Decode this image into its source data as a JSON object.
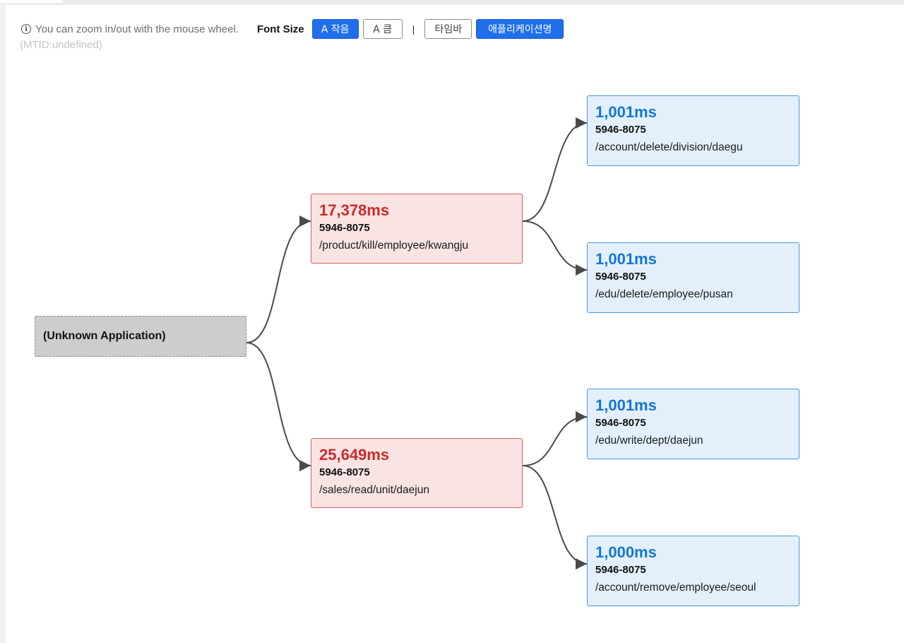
{
  "toolbar": {
    "hint": "You can zoom in/out with the mouse wheel.",
    "font_size_label": "Font Size",
    "btn_small": "A 작음",
    "btn_large": "A 큼",
    "separator": "|",
    "btn_timebar": "타임바",
    "btn_appname": "애플리케이션명"
  },
  "mtid": "(MTID:undefined)",
  "colors": {
    "slow": "#cc2b2b",
    "normal": "#1477d4",
    "accent": "#1f6feb"
  },
  "nodes": {
    "root": {
      "label": "(Unknown Application)"
    },
    "n1": {
      "ms": "17,378ms",
      "id": "5946-8075",
      "path": "/product/kill/employee/kwangju"
    },
    "n2": {
      "ms": "25,649ms",
      "id": "5946-8075",
      "path": "/sales/read/unit/daejun"
    },
    "n3": {
      "ms": "1,001ms",
      "id": "5946-8075",
      "path": "/account/delete/division/daegu"
    },
    "n4": {
      "ms": "1,001ms",
      "id": "5946-8075",
      "path": "/edu/delete/employee/pusan"
    },
    "n5": {
      "ms": "1,001ms",
      "id": "5946-8075",
      "path": "/edu/write/dept/daejun"
    },
    "n6": {
      "ms": "1,000ms",
      "id": "5946-8075",
      "path": "/account/remove/employee/seoul"
    }
  },
  "edges": [
    {
      "from": "root",
      "to": "n1"
    },
    {
      "from": "root",
      "to": "n2"
    },
    {
      "from": "n1",
      "to": "n3"
    },
    {
      "from": "n1",
      "to": "n4"
    },
    {
      "from": "n2",
      "to": "n5"
    },
    {
      "from": "n2",
      "to": "n6"
    }
  ]
}
